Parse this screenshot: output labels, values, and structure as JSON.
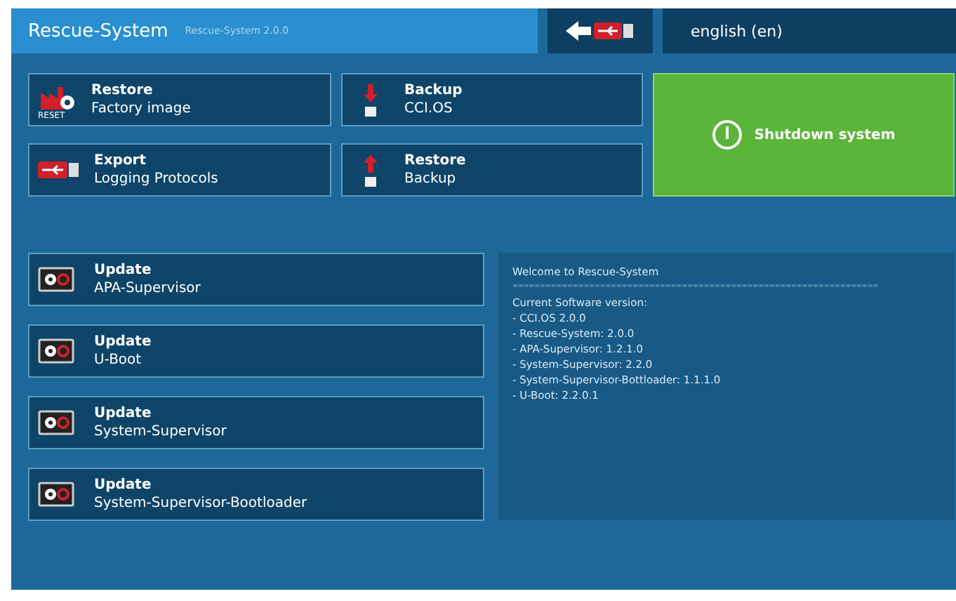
{
  "header": {
    "title": "Rescue-System",
    "version": "Rescue-System 2.0.0",
    "language": "english (en)"
  },
  "actions": [
    {
      "kind": "reset",
      "title": "Restore",
      "subtitle": "Factory image",
      "icon_text": "RESET"
    },
    {
      "kind": "backup",
      "title": "Backup",
      "subtitle": "CCI.OS"
    },
    {
      "kind": "usb",
      "title": "Export",
      "subtitle": "Logging Protocols"
    },
    {
      "kind": "restore",
      "title": "Restore",
      "subtitle": "Backup"
    }
  ],
  "shutdown": {
    "label": "Shutdown system"
  },
  "updates": [
    {
      "title": "Update",
      "subtitle": "APA-Supervisor"
    },
    {
      "title": "Update",
      "subtitle": "U-Boot"
    },
    {
      "title": "Update",
      "subtitle": "System-Supervisor"
    },
    {
      "title": "Update",
      "subtitle": "System-Supervisor-Bootloader"
    }
  ],
  "info": {
    "heading": "Welcome to Rescue-System",
    "separator": "===================================================================",
    "lines": [
      "Current Software version:",
      "- CCI.OS 2.0.0",
      "- Rescue-System: 2.0.0",
      "- APA-Supervisor: 1.2.1.0",
      "- System-Supervisor: 2.2.0",
      "- System-Supervisor-Bottloader: 1.1.1.0",
      "- U-Boot: 2.2.0.1"
    ]
  }
}
